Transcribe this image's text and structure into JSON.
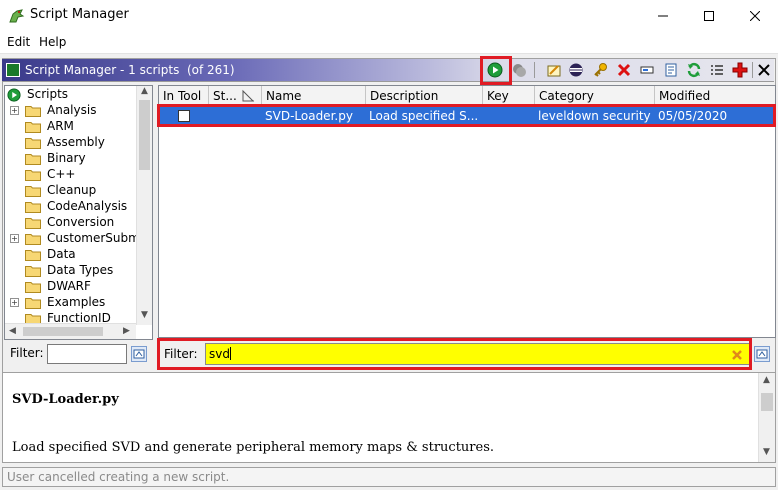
{
  "window": {
    "title": "Script Manager"
  },
  "menu": [
    "Edit",
    "Help"
  ],
  "panel": {
    "title": "Script Manager - 1 scripts  (of 261)"
  },
  "toolbar": {
    "icons": [
      "run-script-icon",
      "run-last-script-icon",
      "edit-script-icon",
      "eclipse-icon",
      "key-binding-icon",
      "delete-script-icon",
      "rename-icon",
      "new-script-icon",
      "refresh-icon",
      "script-directories-icon",
      "help-icon",
      "close-icon"
    ]
  },
  "tree": {
    "root": "Scripts",
    "items": [
      {
        "label": "Analysis",
        "expandable": true
      },
      {
        "label": "ARM",
        "expandable": false
      },
      {
        "label": "Assembly",
        "expandable": false
      },
      {
        "label": "Binary",
        "expandable": false
      },
      {
        "label": "C++",
        "expandable": false
      },
      {
        "label": "Cleanup",
        "expandable": false
      },
      {
        "label": "CodeAnalysis",
        "expandable": false
      },
      {
        "label": "Conversion",
        "expandable": false
      },
      {
        "label": "CustomerSubm",
        "expandable": true
      },
      {
        "label": "Data",
        "expandable": false
      },
      {
        "label": "Data Types",
        "expandable": false
      },
      {
        "label": "DWARF",
        "expandable": false
      },
      {
        "label": "Examples",
        "expandable": true
      },
      {
        "label": "FunctionID",
        "expandable": false
      }
    ],
    "filter_label": "Filter:",
    "filter_value": ""
  },
  "table": {
    "columns": [
      "In Tool",
      "St...",
      "Name",
      "Description",
      "Key",
      "Category",
      "Modified"
    ],
    "rows": [
      {
        "in_tool": false,
        "status": "",
        "name": "SVD-Loader.py",
        "description": "Load specified S...",
        "key": "",
        "category": "leveldown security",
        "modified": "05/05/2020"
      }
    ]
  },
  "filter": {
    "label": "Filter:",
    "value": "svd"
  },
  "description": {
    "title": "SVD-Loader.py",
    "body": "Load specified SVD and generate peripheral memory maps & structures."
  },
  "status": "User cancelled creating a new script.",
  "colors": {
    "highlight": "#e01b24",
    "selection": "#2d6ed6",
    "filter_bg": "#ffff00"
  }
}
